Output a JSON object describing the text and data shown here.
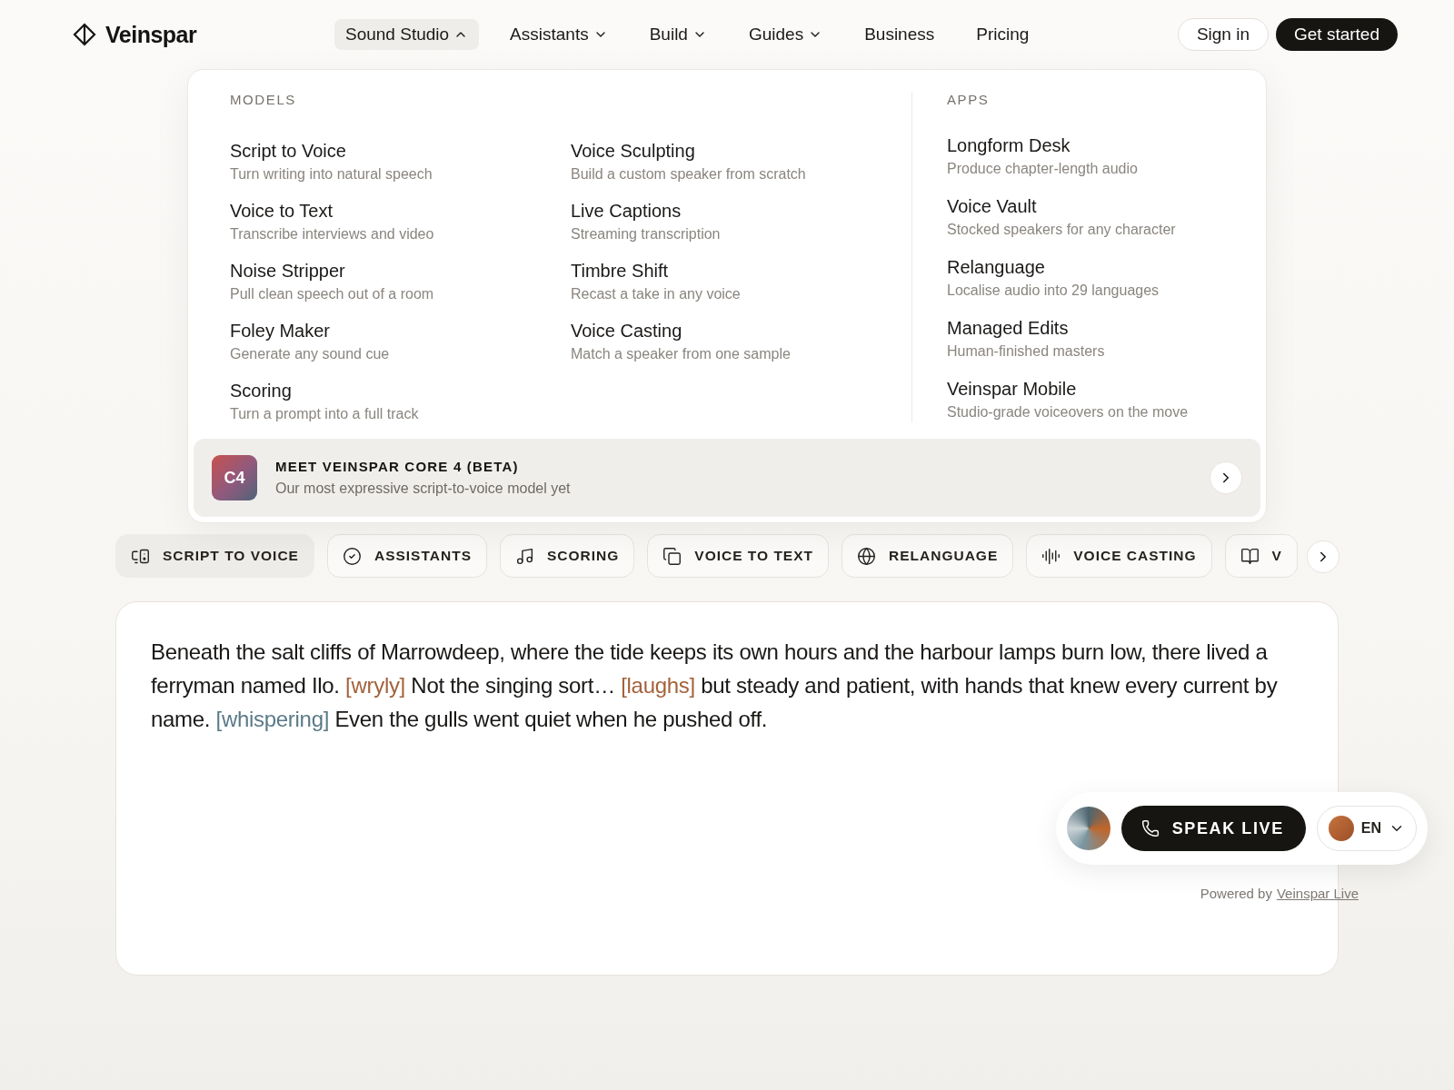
{
  "nav": {
    "logo": "Veinspar",
    "items": [
      {
        "label": "Sound Studio",
        "dropdown": true,
        "selected": true
      },
      {
        "label": "Assistants",
        "dropdown": true,
        "selected": false
      },
      {
        "label": "Build",
        "dropdown": true,
        "selected": false
      },
      {
        "label": "Guides",
        "dropdown": true,
        "selected": false
      },
      {
        "label": "Business",
        "dropdown": false,
        "selected": false
      },
      {
        "label": "Pricing",
        "dropdown": false,
        "selected": false
      }
    ],
    "sign_in": "Sign in",
    "get_started": "Get started"
  },
  "menu": {
    "models": {
      "heading": "MODELS",
      "columns": [
        [
          {
            "title": "Script to Voice",
            "description": "Turn writing into natural speech"
          },
          {
            "title": "Voice to Text",
            "description": "Transcribe interviews and video"
          },
          {
            "title": "Noise Stripper",
            "description": "Pull clean speech out of a room"
          },
          {
            "title": "Foley Maker",
            "description": "Generate any sound cue"
          },
          {
            "title": "Scoring",
            "description": "Turn a prompt into a full track"
          }
        ],
        [
          {
            "title": "Voice Sculpting",
            "description": "Build a custom speaker from scratch"
          },
          {
            "title": "Live Captions",
            "description": "Streaming transcription"
          },
          {
            "title": "Timbre Shift",
            "description": "Recast a take in any voice"
          },
          {
            "title": "Voice Casting",
            "description": "Match a speaker from one sample"
          }
        ]
      ]
    },
    "apps": {
      "heading": "APPS",
      "items": [
        {
          "title": "Longform Desk",
          "description": "Produce chapter-length audio"
        },
        {
          "title": "Voice Vault",
          "description": "Stocked speakers for any character"
        },
        {
          "title": "Relanguage",
          "description": "Localise audio into 29 languages"
        },
        {
          "title": "Managed Edits",
          "description": "Human-finished masters"
        },
        {
          "title": "Veinspar Mobile",
          "description": "Studio-grade voiceovers on the move"
        }
      ]
    },
    "banner": {
      "badge": "C4",
      "title": "MEET VEINSPAR CORE 4 (BETA)",
      "subtitle": "Our most expressive script-to-voice model yet"
    }
  },
  "chips": [
    {
      "label": "SCRIPT TO VOICE",
      "selected": true
    },
    {
      "label": "ASSISTANTS",
      "selected": false
    },
    {
      "label": "SCORING",
      "selected": false
    },
    {
      "label": "VOICE TO TEXT",
      "selected": false
    },
    {
      "label": "RELANGUAGE",
      "selected": false
    },
    {
      "label": "VOICE CASTING",
      "selected": false
    },
    {
      "label": "V",
      "selected": false
    }
  ],
  "editor": {
    "segments": [
      {
        "kind": "plain",
        "text": "Beneath the salt cliffs of Marrowdeep, where the tide keeps its own hours and the harbour lamps burn low, there lived a ferryman named Ilo. "
      },
      {
        "kind": "tag",
        "text": "[wryly]",
        "color": "#a3623b"
      },
      {
        "kind": "plain",
        "text": " Not the singing sort… "
      },
      {
        "kind": "tag",
        "text": "[laughs]",
        "color": "#a3623b"
      },
      {
        "kind": "plain",
        "text": " but steady and patient, with hands that knew every current by name. "
      },
      {
        "kind": "tag",
        "text": "[whispering]",
        "color": "#5a7a88"
      },
      {
        "kind": "plain",
        "text": " Even the gulls went quiet when he pushed off."
      }
    ]
  },
  "live": {
    "button": "SPEAK LIVE",
    "language": "EN",
    "powered_prefix": "Powered by",
    "powered_link": "Veinspar Live"
  }
}
